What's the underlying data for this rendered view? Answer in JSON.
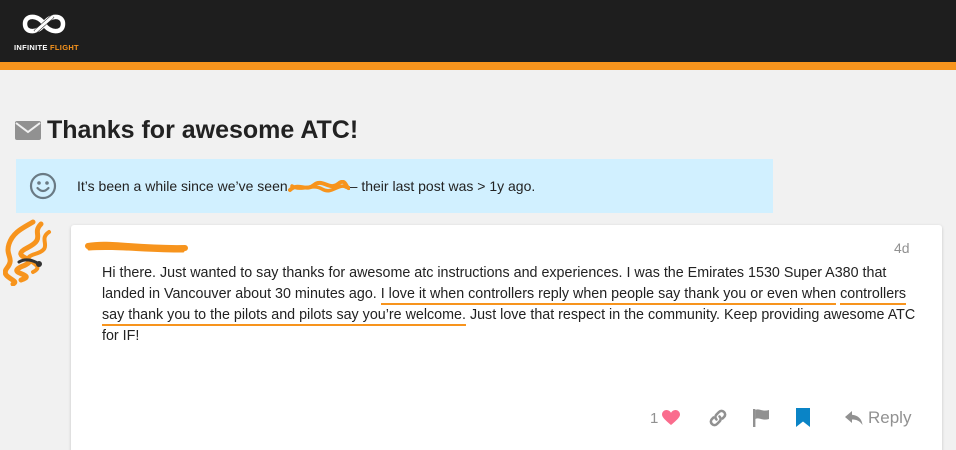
{
  "header": {
    "logo_word_1": "INFINITE",
    "logo_word_2": "FLIGHT",
    "brand_color": "#f7941d",
    "bar_color": "#1e1e1e"
  },
  "topic": {
    "title": "Thanks for awesome ATC!",
    "icon": "envelope-icon"
  },
  "notice": {
    "icon": "smile-icon",
    "text_before": "It’s been a while since we’ve seen",
    "text_after": "– their last post was > 1y ago.",
    "background": "#d1f0ff"
  },
  "post": {
    "date": "4d",
    "body_part_1": "Hi there. Just wanted to say thanks for awesome atc instructions and experiences. I was the Emirates 1530 Super A380 that landed in Vancouver about 30 minutes ago. ",
    "body_highlight_1": "I love it when controllers reply when people say thank you or even when",
    "body_highlight_2": "controllers say thank you to the pilots and pilots say you’re welcome.",
    "body_part_2": " Just love that respect in the community. Keep providing awesome ATC for IF!",
    "actions": {
      "like_count": "1",
      "reply_label": "Reply",
      "like_icon": "heart-icon",
      "link_icon": "link-icon",
      "flag_icon": "flag-icon",
      "bookmark_icon": "bookmark-icon",
      "reply_icon": "reply-icon"
    }
  }
}
